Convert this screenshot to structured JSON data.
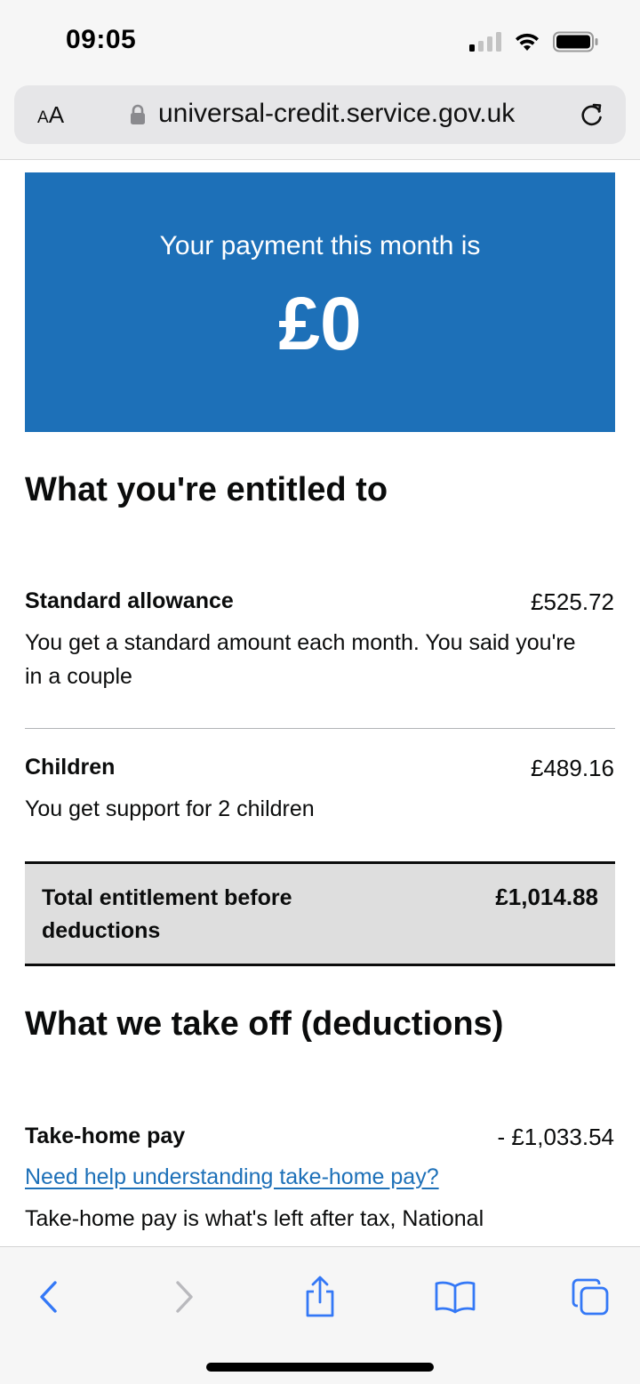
{
  "status_bar": {
    "time": "09:05"
  },
  "browser": {
    "text_size_label_small": "A",
    "text_size_label_large": "A",
    "url": "universal-credit.service.gov.uk"
  },
  "payment": {
    "label": "Your payment this month is",
    "amount": "£0"
  },
  "entitlement": {
    "heading": "What you're entitled to",
    "items": [
      {
        "title": "Standard allowance",
        "value": "£525.72",
        "description": "You get a standard amount each month. You said you're in a couple"
      },
      {
        "title": "Children",
        "value": "£489.16",
        "description": "You get support for 2 children"
      }
    ],
    "total_label": "Total entitlement before deductions",
    "total_value": "£1,014.88"
  },
  "deductions": {
    "heading": "What we take off (deductions)",
    "items": [
      {
        "title": "Take-home pay",
        "value": "- £1,033.54",
        "help_link": "Need help understanding take-home pay?",
        "description": "Take-home pay is what's left after tax, National"
      }
    ]
  },
  "colors": {
    "panel_blue": "#1d70b8",
    "link_blue": "#1d70b8",
    "ios_blue": "#3478f6",
    "text": "#0b0c0c",
    "total_background": "#dedede"
  },
  "toolbar": {
    "icons": [
      "back-icon",
      "forward-icon",
      "share-icon",
      "bookmarks-icon",
      "tabs-icon"
    ]
  }
}
